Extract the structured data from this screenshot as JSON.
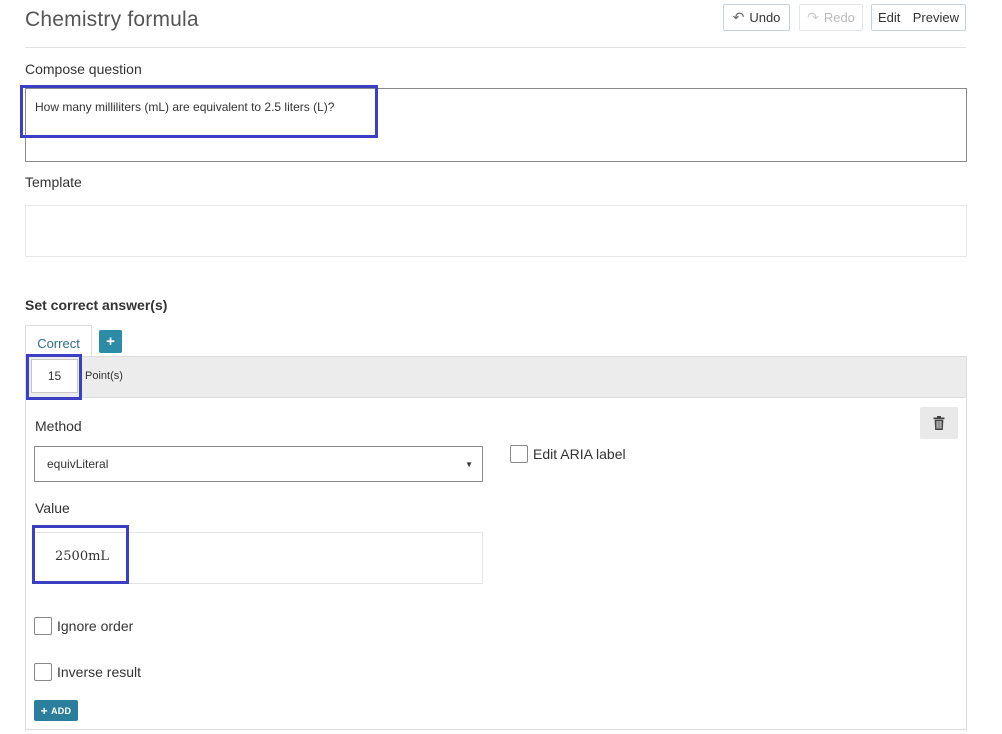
{
  "page": {
    "title": "Chemistry formula"
  },
  "toolbar": {
    "undo_label": "Undo",
    "redo_label": "Redo",
    "edit_label": "Edit",
    "preview_label": "Preview"
  },
  "compose": {
    "label": "Compose question",
    "question_text": "How many milliliters (mL) are equivalent to 2.5 liters (L)?"
  },
  "template": {
    "label": "Template",
    "value": ""
  },
  "answers": {
    "section_title": "Set correct answer(s)",
    "tab_label": "Correct",
    "points_value": "15",
    "points_label": "Point(s)",
    "method_label": "Method",
    "method_selected": "equivLiteral",
    "aria_label": "Edit ARIA label",
    "value_label": "Value",
    "value_text": "2500mL",
    "ignore_order_label": "Ignore order",
    "inverse_result_label": "Inverse result",
    "add_label": "ADD"
  },
  "colors": {
    "accent": "#2c8ba5",
    "highlight_box": "#3b3fc4",
    "tab_text": "#2d6e8e"
  },
  "icons": {
    "undo": "undo-arrow-icon",
    "redo": "redo-arrow-icon",
    "tab_add": "plus-icon",
    "trash": "trash-icon",
    "dropdown": "caret-down-icon",
    "add": "plus-icon"
  }
}
